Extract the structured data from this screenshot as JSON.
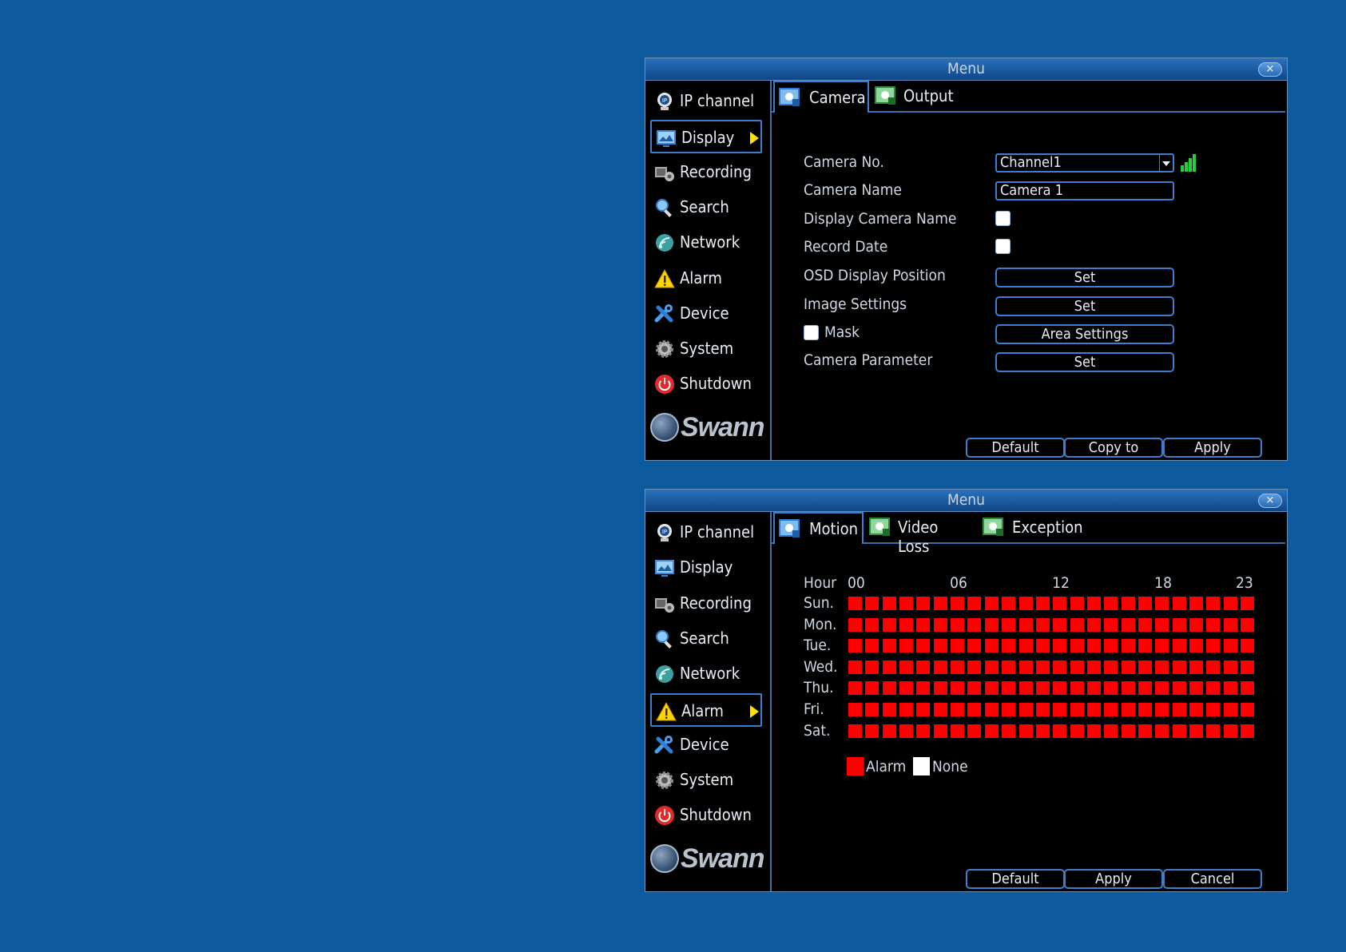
{
  "window1": {
    "title": "Menu",
    "close": "×",
    "sidebar": [
      {
        "label": "IP channel",
        "icon": "ip-camera-icon"
      },
      {
        "label": "Display",
        "icon": "display-icon",
        "active": true
      },
      {
        "label": "Recording",
        "icon": "recording-icon"
      },
      {
        "label": "Search",
        "icon": "search-icon"
      },
      {
        "label": "Network",
        "icon": "network-icon"
      },
      {
        "label": "Alarm",
        "icon": "alarm-icon"
      },
      {
        "label": "Device",
        "icon": "device-icon"
      },
      {
        "label": "System",
        "icon": "system-icon"
      },
      {
        "label": "Shutdown",
        "icon": "shutdown-icon"
      }
    ],
    "logo": "Swann",
    "tabs": [
      {
        "label": "Camera",
        "active": true
      },
      {
        "label": "Output"
      }
    ],
    "form": {
      "camera_no_label": "Camera No.",
      "camera_no_value": "Channel1",
      "camera_name_label": "Camera Name",
      "camera_name_value": "Camera 1",
      "display_camera_name_label": "Display Camera Name",
      "record_date_label": "Record Date",
      "osd_label": "OSD Display Position",
      "osd_button": "Set",
      "image_label": "Image Settings",
      "image_button": "Set",
      "mask_label": "Mask",
      "mask_button": "Area Settings",
      "param_label": "Camera Parameter",
      "param_button": "Set"
    },
    "footer": {
      "default": "Default",
      "copy": "Copy to",
      "apply": "Apply"
    },
    "colors": {
      "signal": "#23d23b"
    }
  },
  "window2": {
    "title": "Menu",
    "close": "×",
    "sidebar": [
      {
        "label": "IP channel",
        "icon": "ip-camera-icon"
      },
      {
        "label": "Display",
        "icon": "display-icon"
      },
      {
        "label": "Recording",
        "icon": "recording-icon"
      },
      {
        "label": "Search",
        "icon": "search-icon"
      },
      {
        "label": "Network",
        "icon": "network-icon"
      },
      {
        "label": "Alarm",
        "icon": "alarm-icon",
        "active": true
      },
      {
        "label": "Device",
        "icon": "device-icon"
      },
      {
        "label": "System",
        "icon": "system-icon"
      },
      {
        "label": "Shutdown",
        "icon": "shutdown-icon"
      }
    ],
    "logo": "Swann",
    "tabs": [
      {
        "label": "Motion",
        "active": true
      },
      {
        "label": "Video Loss"
      },
      {
        "label": "Exception"
      }
    ],
    "schedule": {
      "hour_label": "Hour",
      "hour_ticks": [
        "00",
        "06",
        "12",
        "18",
        "23"
      ],
      "days": [
        "Sun.",
        "Mon.",
        "Tue.",
        "Wed.",
        "Thu.",
        "Fri.",
        "Sat."
      ],
      "hours_per_day": 24,
      "all_alarm": true
    },
    "legend": {
      "alarm": "Alarm",
      "none": "None",
      "alarm_color": "#ff0000",
      "none_color": "#ffffff"
    },
    "footer": {
      "default": "Default",
      "apply": "Apply",
      "cancel": "Cancel"
    }
  }
}
